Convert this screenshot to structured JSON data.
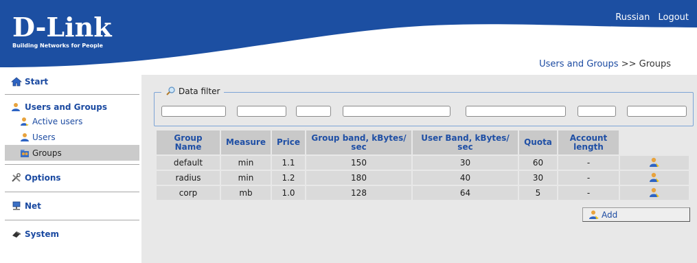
{
  "header": {
    "brand": "D-Link",
    "tagline": "Building Networks for People",
    "lang_link": "Russian",
    "logout_link": "Logout"
  },
  "breadcrumb": {
    "parent": "Users and Groups",
    "separator": ">>",
    "current": "Groups"
  },
  "sidebar": {
    "start": "Start",
    "users_and_groups": "Users and Groups",
    "active_users": "Active users",
    "users": "Users",
    "groups": "Groups",
    "options": "Options",
    "net": "Net",
    "system": "System"
  },
  "filter": {
    "legend": "Data filter",
    "values": [
      "",
      "",
      "",
      "",
      "",
      "",
      ""
    ]
  },
  "table": {
    "headers": [
      "Group Name",
      "Measure",
      "Price",
      "Group band, kBytes/ sec",
      "User Band, kBytes/ sec",
      "Quota",
      "Account length",
      ""
    ],
    "rows": [
      [
        "default",
        "min",
        "1.1",
        "150",
        "30",
        "60",
        "-"
      ],
      [
        "radius",
        "min",
        "1.2",
        "180",
        "40",
        "30",
        "-"
      ],
      [
        "corp",
        "mb",
        "1.0",
        "128",
        "64",
        "5",
        "-"
      ]
    ]
  },
  "add_button": {
    "label": "Add"
  },
  "colors": {
    "brand_blue": "#1c4fa2",
    "link_blue": "#1b4aa1",
    "panel_gray": "#e8e8e8",
    "cell_gray": "#dadada",
    "header_gray": "#c9c9c9"
  },
  "icons": {
    "start": "home-icon",
    "users": "user-icon",
    "groups": "group-icon",
    "options": "tools-icon",
    "net": "network-icon",
    "system": "gear-icon",
    "filter": "magnifier-icon",
    "edit": "edit-user-icon",
    "add": "add-user-icon"
  }
}
